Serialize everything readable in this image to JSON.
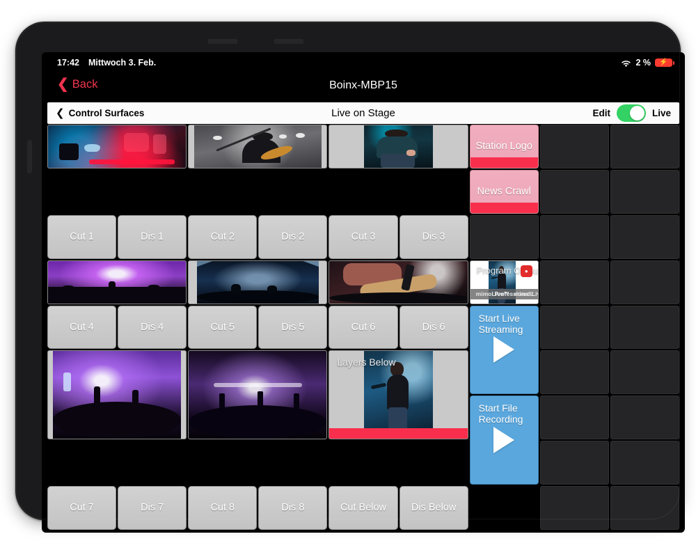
{
  "status_bar": {
    "time": "17:42",
    "date": "Mittwoch 3. Feb.",
    "battery_percent": "2 %",
    "wifi_icon": "wifi-icon",
    "battery_icon": "battery-charging-icon"
  },
  "app_bar": {
    "back_label": "Back",
    "back_chevron": "chevron-left-icon",
    "device_title": "Boinx-MBP15"
  },
  "toolbar": {
    "back_label": "Control Surfaces",
    "back_chevron": "chevron-left-icon",
    "title": "Live on Stage",
    "edit_label": "Edit",
    "live_label": "Live",
    "toggle_state": "on",
    "toggle_color": "#34d264"
  },
  "colors": {
    "screen_bg": "#000000",
    "empty_cell": "#252527",
    "gray_button": "#c8c8c8",
    "pink_layer": "#eda6b8",
    "red_bar": "#f82f4c",
    "blue_action": "#5aa7dd",
    "accent_red": "#f1344f"
  },
  "grid": {
    "columns": 9,
    "rows": 9,
    "cells": [
      {
        "id": "src-1",
        "kind": "video",
        "label": "",
        "col": 1,
        "row": 1,
        "colspan": 2,
        "rowspan": 1,
        "art": "ph-stage1",
        "thumb_width": "100%",
        "live_bar": false
      },
      {
        "id": "src-2",
        "kind": "video",
        "label": "",
        "col": 3,
        "row": 1,
        "colspan": 2,
        "rowspan": 1,
        "art": "ph-guitar",
        "thumb_width": "92%",
        "live_bar": false
      },
      {
        "id": "src-3",
        "kind": "video",
        "label": "",
        "col": 5,
        "row": 1,
        "colspan": 2,
        "rowspan": 1,
        "art": "ph-singer",
        "thumb_width": "50%",
        "live_bar": false
      },
      {
        "id": "station-logo",
        "kind": "pink",
        "label": "Station Logo",
        "col": 7,
        "row": 1,
        "colspan": 1,
        "rowspan": 1,
        "live_bar": true
      },
      {
        "id": "empty-8-1",
        "kind": "empty",
        "label": "",
        "col": 8,
        "row": 1,
        "colspan": 1,
        "rowspan": 1
      },
      {
        "id": "empty-9-1",
        "kind": "empty",
        "label": "",
        "col": 9,
        "row": 1,
        "colspan": 1,
        "rowspan": 1
      },
      {
        "id": "news-crawl",
        "kind": "pink",
        "label": "News Crawl",
        "col": 7,
        "row": 2,
        "colspan": 1,
        "rowspan": 1,
        "live_bar": true
      },
      {
        "id": "empty-8-2",
        "kind": "empty",
        "label": "",
        "col": 8,
        "row": 2,
        "colspan": 1,
        "rowspan": 1
      },
      {
        "id": "empty-9-2",
        "kind": "empty",
        "label": "",
        "col": 9,
        "row": 2,
        "colspan": 1,
        "rowspan": 1
      },
      {
        "id": "cut-1",
        "kind": "gray",
        "label": "Cut 1",
        "col": 1,
        "row": 3,
        "colspan": 1,
        "rowspan": 1
      },
      {
        "id": "dis-1",
        "kind": "gray",
        "label": "Dis 1",
        "col": 2,
        "row": 3,
        "colspan": 1,
        "rowspan": 1
      },
      {
        "id": "cut-2",
        "kind": "gray",
        "label": "Cut 2",
        "col": 3,
        "row": 3,
        "colspan": 1,
        "rowspan": 1
      },
      {
        "id": "dis-2",
        "kind": "gray",
        "label": "Dis 2",
        "col": 4,
        "row": 3,
        "colspan": 1,
        "rowspan": 1
      },
      {
        "id": "cut-3",
        "kind": "gray",
        "label": "Cut 3",
        "col": 5,
        "row": 3,
        "colspan": 1,
        "rowspan": 1
      },
      {
        "id": "dis-3",
        "kind": "gray",
        "label": "Dis 3",
        "col": 6,
        "row": 3,
        "colspan": 1,
        "rowspan": 1
      },
      {
        "id": "empty-7-3",
        "kind": "empty",
        "label": "",
        "col": 7,
        "row": 3,
        "colspan": 1,
        "rowspan": 1
      },
      {
        "id": "empty-8-3",
        "kind": "empty",
        "label": "",
        "col": 8,
        "row": 3,
        "colspan": 1,
        "rowspan": 1
      },
      {
        "id": "empty-9-3",
        "kind": "empty",
        "label": "",
        "col": 9,
        "row": 3,
        "colspan": 1,
        "rowspan": 1
      },
      {
        "id": "src-4",
        "kind": "video",
        "label": "",
        "col": 1,
        "row": 4,
        "colspan": 2,
        "rowspan": 1,
        "art": "ph-crowd1",
        "thumb_width": "100%",
        "live_bar": false
      },
      {
        "id": "src-5",
        "kind": "video",
        "label": "",
        "col": 3,
        "row": 4,
        "colspan": 2,
        "rowspan": 1,
        "art": "ph-beams",
        "thumb_width": "88%",
        "live_bar": false
      },
      {
        "id": "src-6",
        "kind": "video",
        "label": "",
        "col": 5,
        "row": 4,
        "colspan": 2,
        "rowspan": 1,
        "art": "ph-guitar2",
        "thumb_width": "100%",
        "live_bar": false
      },
      {
        "id": "program-output",
        "kind": "program",
        "label": "Program Output",
        "col": 7,
        "row": 4,
        "colspan": 1,
        "rowspan": 1,
        "lower_third": {
          "left": "mimoLive™",
          "center": "Professional Live Video",
          "right": "mimoL"
        },
        "badge": "recording-badge-icon"
      },
      {
        "id": "empty-8-4",
        "kind": "empty",
        "label": "",
        "col": 8,
        "row": 4,
        "colspan": 1,
        "rowspan": 1
      },
      {
        "id": "empty-9-4",
        "kind": "empty",
        "label": "",
        "col": 9,
        "row": 4,
        "colspan": 1,
        "rowspan": 1
      },
      {
        "id": "cut-4",
        "kind": "gray",
        "label": "Cut 4",
        "col": 1,
        "row": 5,
        "colspan": 1,
        "rowspan": 1
      },
      {
        "id": "dis-4",
        "kind": "gray",
        "label": "Dis 4",
        "col": 2,
        "row": 5,
        "colspan": 1,
        "rowspan": 1
      },
      {
        "id": "cut-5",
        "kind": "gray",
        "label": "Cut 5",
        "col": 3,
        "row": 5,
        "colspan": 1,
        "rowspan": 1
      },
      {
        "id": "dis-5",
        "kind": "gray",
        "label": "Dis 5",
        "col": 4,
        "row": 5,
        "colspan": 1,
        "rowspan": 1
      },
      {
        "id": "cut-6",
        "kind": "gray",
        "label": "Cut 6",
        "col": 5,
        "row": 5,
        "colspan": 1,
        "rowspan": 1
      },
      {
        "id": "dis-6",
        "kind": "gray",
        "label": "Dis 6",
        "col": 6,
        "row": 5,
        "colspan": 1,
        "rowspan": 1
      },
      {
        "id": "start-live-streaming",
        "kind": "blue",
        "label": "Start Live Streaming",
        "col": 7,
        "row": 5,
        "colspan": 1,
        "rowspan": 2,
        "play_icon": "play-icon"
      },
      {
        "id": "empty-8-5",
        "kind": "empty",
        "label": "",
        "col": 8,
        "row": 5,
        "colspan": 1,
        "rowspan": 1
      },
      {
        "id": "empty-9-5",
        "kind": "empty",
        "label": "",
        "col": 9,
        "row": 5,
        "colspan": 1,
        "rowspan": 1
      },
      {
        "id": "src-7",
        "kind": "video",
        "label": "",
        "col": 1,
        "row": 6,
        "colspan": 2,
        "rowspan": 2,
        "art": "ph-crowd2",
        "thumb_width": "93%",
        "live_bar": false
      },
      {
        "id": "src-8",
        "kind": "video",
        "label": "",
        "col": 3,
        "row": 6,
        "colspan": 2,
        "rowspan": 2,
        "art": "ph-fest",
        "thumb_width": "100%",
        "live_bar": false
      },
      {
        "id": "layers-below",
        "kind": "video",
        "label": "Layers Below",
        "col": 5,
        "row": 6,
        "colspan": 2,
        "rowspan": 2,
        "art": "ph-perf",
        "thumb_width": "50%",
        "live_bar": true
      },
      {
        "id": "empty-8-6",
        "kind": "empty",
        "label": "",
        "col": 8,
        "row": 6,
        "colspan": 1,
        "rowspan": 1
      },
      {
        "id": "empty-9-6",
        "kind": "empty",
        "label": "",
        "col": 9,
        "row": 6,
        "colspan": 1,
        "rowspan": 1
      },
      {
        "id": "start-file-recording",
        "kind": "blue",
        "label": "Start File Recording",
        "col": 7,
        "row": 7,
        "colspan": 1,
        "rowspan": 2,
        "play_icon": "play-icon"
      },
      {
        "id": "empty-8-7",
        "kind": "empty",
        "label": "",
        "col": 8,
        "row": 7,
        "colspan": 1,
        "rowspan": 1
      },
      {
        "id": "empty-9-7",
        "kind": "empty",
        "label": "",
        "col": 9,
        "row": 7,
        "colspan": 1,
        "rowspan": 1
      },
      {
        "id": "empty-8-8",
        "kind": "empty",
        "label": "",
        "col": 8,
        "row": 8,
        "colspan": 1,
        "rowspan": 1
      },
      {
        "id": "empty-9-8",
        "kind": "empty",
        "label": "",
        "col": 9,
        "row": 8,
        "colspan": 1,
        "rowspan": 1
      },
      {
        "id": "cut-7",
        "kind": "gray",
        "label": "Cut 7",
        "col": 1,
        "row": 9,
        "colspan": 1,
        "rowspan": 1
      },
      {
        "id": "dis-7",
        "kind": "gray",
        "label": "Dis 7",
        "col": 2,
        "row": 9,
        "colspan": 1,
        "rowspan": 1
      },
      {
        "id": "cut-8",
        "kind": "gray",
        "label": "Cut 8",
        "col": 3,
        "row": 9,
        "colspan": 1,
        "rowspan": 1
      },
      {
        "id": "dis-8",
        "kind": "gray",
        "label": "Dis 8",
        "col": 4,
        "row": 9,
        "colspan": 1,
        "rowspan": 1
      },
      {
        "id": "cut-below",
        "kind": "gray",
        "label": "Cut Below",
        "col": 5,
        "row": 9,
        "colspan": 1,
        "rowspan": 1
      },
      {
        "id": "dis-below",
        "kind": "gray",
        "label": "Dis Below",
        "col": 6,
        "row": 9,
        "colspan": 1,
        "rowspan": 1
      },
      {
        "id": "empty-8-9",
        "kind": "empty",
        "label": "",
        "col": 8,
        "row": 9,
        "colspan": 1,
        "rowspan": 1
      },
      {
        "id": "empty-9-9",
        "kind": "empty",
        "label": "",
        "col": 9,
        "row": 9,
        "colspan": 1,
        "rowspan": 1
      }
    ]
  }
}
